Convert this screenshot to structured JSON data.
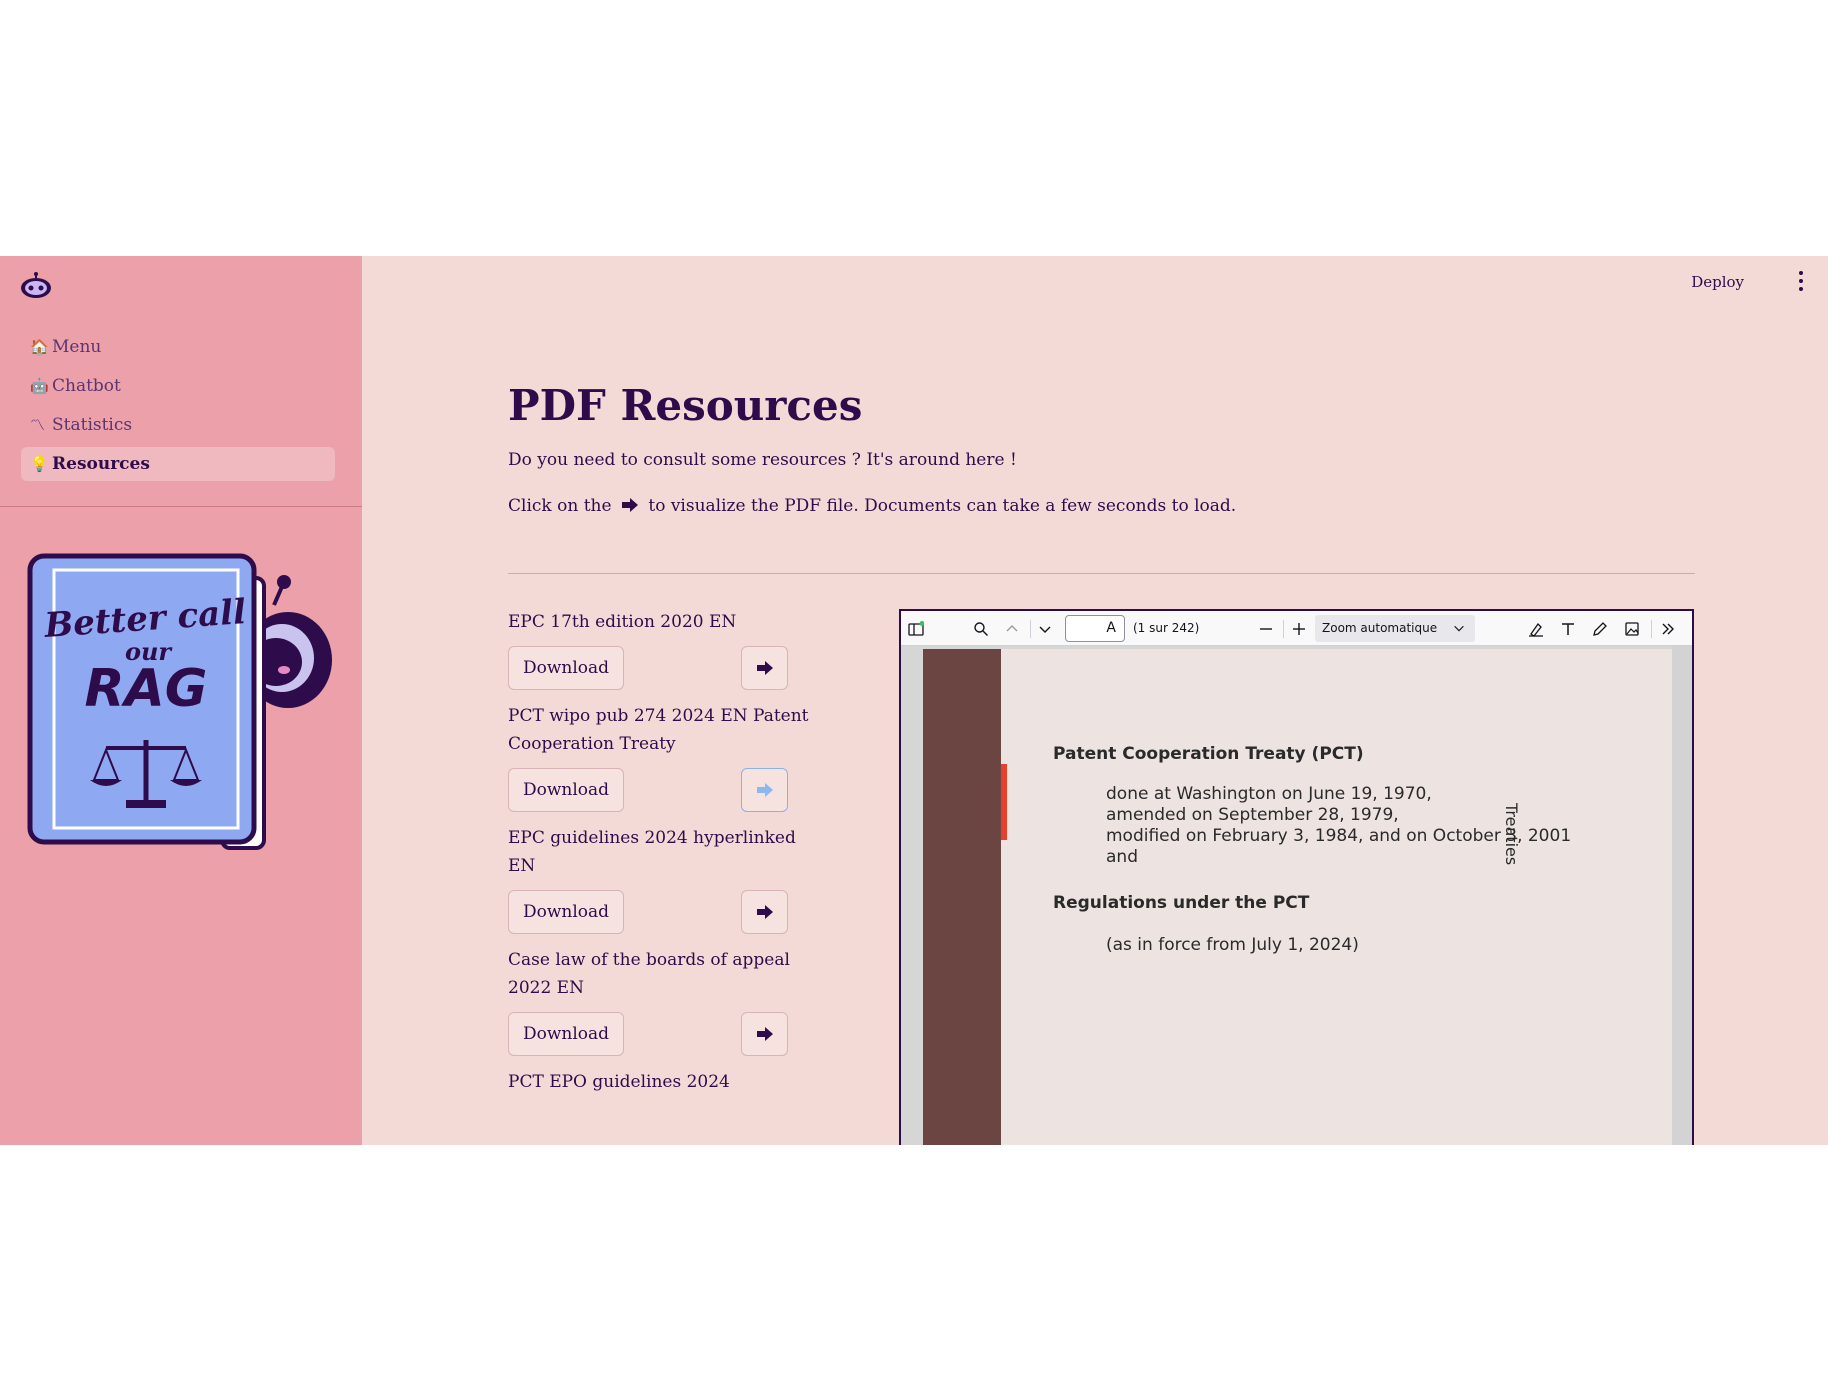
{
  "header": {
    "deploy_label": "Deploy"
  },
  "sidebar": {
    "items": [
      {
        "emoji": "🏠",
        "label": "Menu",
        "active": false
      },
      {
        "emoji": "🤖",
        "label": "Chatbot",
        "active": false
      },
      {
        "emoji": "〽",
        "label": "Statistics",
        "active": false
      },
      {
        "emoji": "💡",
        "label": "Resources",
        "active": true
      }
    ],
    "logo_text": {
      "line1": "Better call",
      "line2": "our",
      "line3": "RAG"
    }
  },
  "main": {
    "title": "PDF Resources",
    "intro_line1": "Do you need to consult some resources ? It's around here !",
    "intro_line2_before": "Click on the",
    "intro_line2_after": "to visualize the PDF file. Documents can take a few seconds to load.",
    "download_label": "Download",
    "documents": [
      {
        "title": "EPC 17th edition 2020 EN"
      },
      {
        "title": "PCT wipo pub 274 2024 EN Patent Cooperation Treaty"
      },
      {
        "title": "EPC guidelines 2024 hyperlinked EN"
      },
      {
        "title": "Case law of the boards of appeal 2022 EN"
      },
      {
        "title": "PCT EPO guidelines 2024"
      }
    ]
  },
  "pdf_viewer": {
    "page_input_value": "A",
    "page_count": "(1 sur 242)",
    "zoom_value": "Zoom automatique",
    "page": {
      "heading1": "Patent Cooperation Treaty (PCT)",
      "line1": "done at Washington on June 19, 1970,",
      "line2": "amended on September 28, 1979,",
      "line3": "modified on February 3, 1984, and on October 3, 2001",
      "line4": "and",
      "heading2": "Regulations under the PCT",
      "line5": "(as in force from July 1, 2024)",
      "side_label": "Treaties"
    }
  },
  "colors": {
    "accent": "#2e0b4a",
    "sidebar_bg": "#eba0aa",
    "main_bg": "#f4dad6"
  }
}
